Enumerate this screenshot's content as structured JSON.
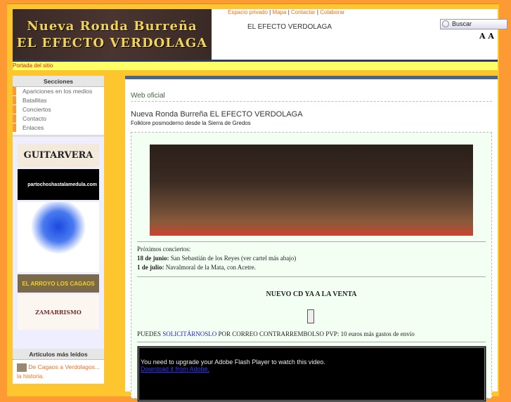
{
  "header": {
    "banner_line1": "Nueva Ronda Burreña",
    "banner_line2": "EL EFECTO VERDOLAGA",
    "links": [
      "Espacio privado",
      "Mapa",
      "Contactar",
      "Colaborar"
    ],
    "site_name": "EL EFECTO VERDOLAGA",
    "search_placeholder": "Buscar",
    "font_size_small": "A",
    "font_size_large": "A"
  },
  "breadcrumb": "Portada del sitio",
  "sidebar": {
    "sections_title": "Secciones",
    "sections": [
      "Apariciones en los medios",
      "Batallitas",
      "Conciertos",
      "Contacto",
      "Enlaces"
    ],
    "ads": [
      "GUITARVERA",
      "partochoshastalamedula.com",
      "EL ARROYO LOS CAGAOS",
      "ZAMARRISMO"
    ],
    "most_read_title": "Artículos más leídos",
    "most_read": [
      "De Cagaos a Verdolagos... la historia."
    ]
  },
  "main": {
    "section": "Web oficial",
    "title": "Nueva Ronda Burreña EL EFECTO VERDOLAGA",
    "subtitle": "Folklore posmoderno desde la Sierra de Gredos",
    "concerts_label": "Próximos conciertos:",
    "concerts": [
      {
        "date": "18 de junio:",
        "place": "San Sebastián de los Reyes (ver cartel más abajo)"
      },
      {
        "date": "1 de julio:",
        "place": "Navalmoral de la Mata, con Acetre."
      }
    ],
    "cd_heading": "NUEVO CD YA A LA VENTA",
    "order_pre": "PUEDES",
    "order_link": "SOLICITÁRNOSLO",
    "order_post": "POR CORREO CONTRARREMBOLSO PVP: 10 euros más gastos de envío",
    "flash_msg": "You need to upgrade your Adobe Flash Player to watch this video.",
    "flash_link": "Download it from Adobe."
  }
}
